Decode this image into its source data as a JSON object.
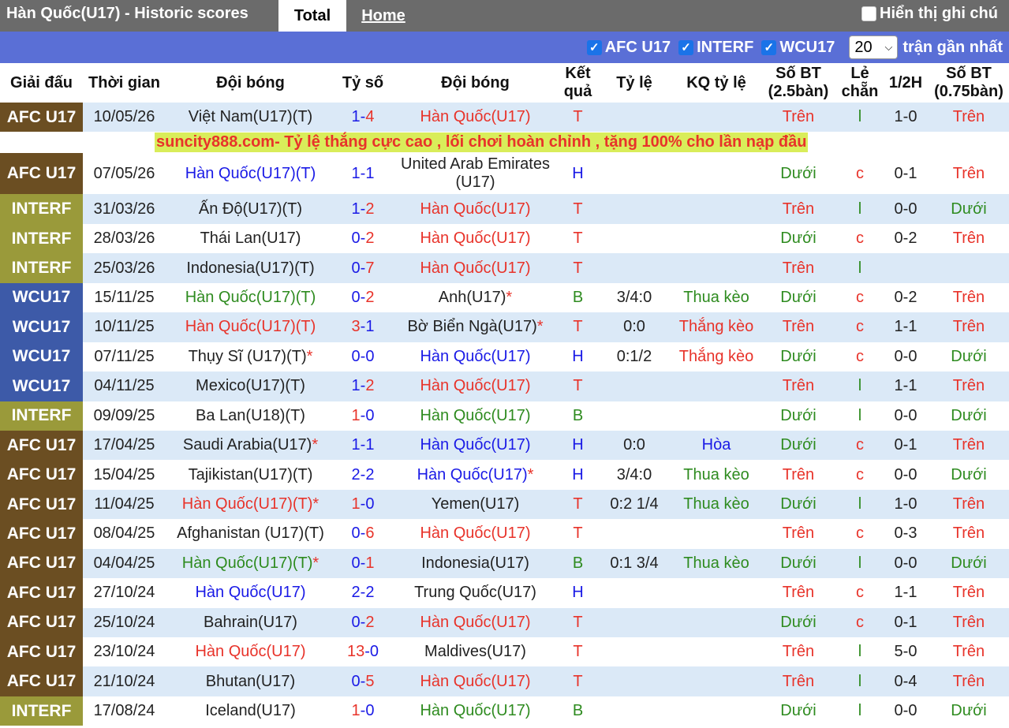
{
  "header": {
    "title": "Hàn Quốc(U17) - Historic scores",
    "tab_total": "Total",
    "tab_home": "Home",
    "show_note": "Hiển thị ghi chú"
  },
  "filters": {
    "afc": "AFC U17",
    "interf": "INTERF",
    "wcu": "WCU17",
    "count": "20",
    "count_label": "trận gần nhất"
  },
  "columns": [
    "Giải đấu",
    "Thời gian",
    "Đội bóng",
    "Tỷ số",
    "Đội bóng",
    "Kết quả",
    "Tỷ lệ",
    "KQ tỷ lệ",
    "Số BT (2.5bàn)",
    "Lẻ chẵn",
    "1/2H",
    "Số BT (0.75bàn)"
  ],
  "league_colors": {
    "AFC U17": "#6b4e22",
    "INTERF": "#9a9a3a",
    "WCU17": "#3d5aa8"
  },
  "promo": "suncity888.com- Tỷ lệ thắng cực cao , lối chơi hoàn chỉnh , tặng 100% cho lần nạp đầu",
  "rows": [
    {
      "league": "AFC U17",
      "date": "10/05/26",
      "home": "Việt Nam(U17)(T)",
      "hc": "black",
      "hs": false,
      "score": "1-4",
      "sa": "blue",
      "sb": "red",
      "away": "Hàn Quốc(U17)",
      "ac": "red",
      "as": false,
      "res": "T",
      "rc": "red",
      "odds": "",
      "kq": "",
      "kc": "",
      "ou": "Trên",
      "oc": "red",
      "oe": "l",
      "ec": "green",
      "ht": "1-0",
      "ou2": "Trên",
      "o2c": "red"
    },
    {
      "league": "AFC U17",
      "date": "07/05/26",
      "home": "Hàn Quốc(U17)(T)",
      "hc": "blue",
      "hs": false,
      "score": "1-1",
      "sa": "blue",
      "sb": "blue",
      "away": "United Arab Emirates (U17)",
      "ac": "black",
      "as": false,
      "res": "H",
      "rc": "blue",
      "odds": "",
      "kq": "",
      "kc": "",
      "ou": "Dưới",
      "oc": "green",
      "oe": "c",
      "ec": "red",
      "ht": "0-1",
      "ou2": "Trên",
      "o2c": "red"
    },
    {
      "league": "INTERF",
      "date": "31/03/26",
      "home": "Ấn Độ(U17)(T)",
      "hc": "black",
      "hs": false,
      "score": "1-2",
      "sa": "blue",
      "sb": "red",
      "away": "Hàn Quốc(U17)",
      "ac": "red",
      "as": false,
      "res": "T",
      "rc": "red",
      "odds": "",
      "kq": "",
      "kc": "",
      "ou": "Trên",
      "oc": "red",
      "oe": "l",
      "ec": "green",
      "ht": "0-0",
      "ou2": "Dưới",
      "o2c": "green"
    },
    {
      "league": "INTERF",
      "date": "28/03/26",
      "home": "Thái Lan(U17)",
      "hc": "black",
      "hs": false,
      "score": "0-2",
      "sa": "blue",
      "sb": "red",
      "away": "Hàn Quốc(U17)",
      "ac": "red",
      "as": false,
      "res": "T",
      "rc": "red",
      "odds": "",
      "kq": "",
      "kc": "",
      "ou": "Dưới",
      "oc": "green",
      "oe": "c",
      "ec": "red",
      "ht": "0-2",
      "ou2": "Trên",
      "o2c": "red"
    },
    {
      "league": "INTERF",
      "date": "25/03/26",
      "home": "Indonesia(U17)(T)",
      "hc": "black",
      "hs": false,
      "score": "0-7",
      "sa": "blue",
      "sb": "red",
      "away": "Hàn Quốc(U17)",
      "ac": "red",
      "as": false,
      "res": "T",
      "rc": "red",
      "odds": "",
      "kq": "",
      "kc": "",
      "ou": "Trên",
      "oc": "red",
      "oe": "l",
      "ec": "green",
      "ht": "",
      "ou2": "",
      "o2c": "red"
    },
    {
      "league": "WCU17",
      "date": "15/11/25",
      "home": "Hàn Quốc(U17)(T)",
      "hc": "green",
      "hs": false,
      "score": "0-2",
      "sa": "blue",
      "sb": "red",
      "away": "Anh(U17)",
      "ac": "black",
      "as": true,
      "res": "B",
      "rc": "green",
      "odds": "3/4:0",
      "kq": "Thua kèo",
      "kc": "green",
      "ou": "Dưới",
      "oc": "green",
      "oe": "c",
      "ec": "red",
      "ht": "0-2",
      "ou2": "Trên",
      "o2c": "red"
    },
    {
      "league": "WCU17",
      "date": "10/11/25",
      "home": "Hàn Quốc(U17)(T)",
      "hc": "red",
      "hs": false,
      "score": "3-1",
      "sa": "red",
      "sb": "blue",
      "away": "Bờ Biển Ngà(U17)",
      "ac": "black",
      "as": true,
      "res": "T",
      "rc": "red",
      "odds": "0:0",
      "kq": "Thắng kèo",
      "kc": "red",
      "ou": "Trên",
      "oc": "red",
      "oe": "c",
      "ec": "red",
      "ht": "1-1",
      "ou2": "Trên",
      "o2c": "red"
    },
    {
      "league": "WCU17",
      "date": "07/11/25",
      "home": "Thụy Sĩ (U17)(T)",
      "hc": "black",
      "hs": true,
      "score": "0-0",
      "sa": "blue",
      "sb": "blue",
      "away": "Hàn Quốc(U17)",
      "ac": "blue",
      "as": false,
      "res": "H",
      "rc": "blue",
      "odds": "0:1/2",
      "kq": "Thắng kèo",
      "kc": "red",
      "ou": "Dưới",
      "oc": "green",
      "oe": "c",
      "ec": "red",
      "ht": "0-0",
      "ou2": "Dưới",
      "o2c": "green"
    },
    {
      "league": "WCU17",
      "date": "04/11/25",
      "home": "Mexico(U17)(T)",
      "hc": "black",
      "hs": false,
      "score": "1-2",
      "sa": "blue",
      "sb": "red",
      "away": "Hàn Quốc(U17)",
      "ac": "red",
      "as": false,
      "res": "T",
      "rc": "red",
      "odds": "",
      "kq": "",
      "kc": "",
      "ou": "Trên",
      "oc": "red",
      "oe": "l",
      "ec": "green",
      "ht": "1-1",
      "ou2": "Trên",
      "o2c": "red"
    },
    {
      "league": "INTERF",
      "date": "09/09/25",
      "home": "Ba Lan(U18)(T)",
      "hc": "black",
      "hs": false,
      "score": "1-0",
      "sa": "red",
      "sb": "blue",
      "away": "Hàn Quốc(U17)",
      "ac": "green",
      "as": false,
      "res": "B",
      "rc": "green",
      "odds": "",
      "kq": "",
      "kc": "",
      "ou": "Dưới",
      "oc": "green",
      "oe": "l",
      "ec": "green",
      "ht": "0-0",
      "ou2": "Dưới",
      "o2c": "green"
    },
    {
      "league": "AFC U17",
      "date": "17/04/25",
      "home": "Saudi Arabia(U17)",
      "hc": "black",
      "hs": true,
      "score": "1-1",
      "sa": "blue",
      "sb": "blue",
      "away": "Hàn Quốc(U17)",
      "ac": "blue",
      "as": false,
      "res": "H",
      "rc": "blue",
      "odds": "0:0",
      "kq": "Hòa",
      "kc": "blue",
      "ou": "Dưới",
      "oc": "green",
      "oe": "c",
      "ec": "red",
      "ht": "0-1",
      "ou2": "Trên",
      "o2c": "red"
    },
    {
      "league": "AFC U17",
      "date": "15/04/25",
      "home": "Tajikistan(U17)(T)",
      "hc": "black",
      "hs": false,
      "score": "2-2",
      "sa": "blue",
      "sb": "blue",
      "away": "Hàn Quốc(U17)",
      "ac": "blue",
      "as": true,
      "res": "H",
      "rc": "blue",
      "odds": "3/4:0",
      "kq": "Thua kèo",
      "kc": "green",
      "ou": "Trên",
      "oc": "red",
      "oe": "c",
      "ec": "red",
      "ht": "0-0",
      "ou2": "Dưới",
      "o2c": "green"
    },
    {
      "league": "AFC U17",
      "date": "11/04/25",
      "home": "Hàn Quốc(U17)(T)",
      "hc": "red",
      "hs": true,
      "score": "1-0",
      "sa": "red",
      "sb": "blue",
      "away": "Yemen(U17)",
      "ac": "black",
      "as": false,
      "res": "T",
      "rc": "red",
      "odds": "0:2 1/4",
      "kq": "Thua kèo",
      "kc": "green",
      "ou": "Dưới",
      "oc": "green",
      "oe": "l",
      "ec": "green",
      "ht": "1-0",
      "ou2": "Trên",
      "o2c": "red"
    },
    {
      "league": "AFC U17",
      "date": "08/04/25",
      "home": "Afghanistan (U17)(T)",
      "hc": "black",
      "hs": false,
      "score": "0-6",
      "sa": "blue",
      "sb": "red",
      "away": "Hàn Quốc(U17)",
      "ac": "red",
      "as": false,
      "res": "T",
      "rc": "red",
      "odds": "",
      "kq": "",
      "kc": "",
      "ou": "Trên",
      "oc": "red",
      "oe": "c",
      "ec": "red",
      "ht": "0-3",
      "ou2": "Trên",
      "o2c": "red"
    },
    {
      "league": "AFC U17",
      "date": "04/04/25",
      "home": "Hàn Quốc(U17)(T)",
      "hc": "green",
      "hs": true,
      "score": "0-1",
      "sa": "blue",
      "sb": "red",
      "away": "Indonesia(U17)",
      "ac": "black",
      "as": false,
      "res": "B",
      "rc": "green",
      "odds": "0:1 3/4",
      "kq": "Thua kèo",
      "kc": "green",
      "ou": "Dưới",
      "oc": "green",
      "oe": "l",
      "ec": "green",
      "ht": "0-0",
      "ou2": "Dưới",
      "o2c": "green"
    },
    {
      "league": "AFC U17",
      "date": "27/10/24",
      "home": "Hàn Quốc(U17)",
      "hc": "blue",
      "hs": false,
      "score": "2-2",
      "sa": "blue",
      "sb": "blue",
      "away": "Trung Quốc(U17)",
      "ac": "black",
      "as": false,
      "res": "H",
      "rc": "blue",
      "odds": "",
      "kq": "",
      "kc": "",
      "ou": "Trên",
      "oc": "red",
      "oe": "c",
      "ec": "red",
      "ht": "1-1",
      "ou2": "Trên",
      "o2c": "red"
    },
    {
      "league": "AFC U17",
      "date": "25/10/24",
      "home": "Bahrain(U17)",
      "hc": "black",
      "hs": false,
      "score": "0-2",
      "sa": "blue",
      "sb": "red",
      "away": "Hàn Quốc(U17)",
      "ac": "red",
      "as": false,
      "res": "T",
      "rc": "red",
      "odds": "",
      "kq": "",
      "kc": "",
      "ou": "Dưới",
      "oc": "green",
      "oe": "c",
      "ec": "red",
      "ht": "0-1",
      "ou2": "Trên",
      "o2c": "red"
    },
    {
      "league": "AFC U17",
      "date": "23/10/24",
      "home": "Hàn Quốc(U17)",
      "hc": "red",
      "hs": false,
      "score": "13-0",
      "sa": "red",
      "sb": "blue",
      "away": "Maldives(U17)",
      "ac": "black",
      "as": false,
      "res": "T",
      "rc": "red",
      "odds": "",
      "kq": "",
      "kc": "",
      "ou": "Trên",
      "oc": "red",
      "oe": "l",
      "ec": "green",
      "ht": "5-0",
      "ou2": "Trên",
      "o2c": "red"
    },
    {
      "league": "AFC U17",
      "date": "21/10/24",
      "home": "Bhutan(U17)",
      "hc": "black",
      "hs": false,
      "score": "0-5",
      "sa": "blue",
      "sb": "red",
      "away": "Hàn Quốc(U17)",
      "ac": "red",
      "as": false,
      "res": "T",
      "rc": "red",
      "odds": "",
      "kq": "",
      "kc": "",
      "ou": "Trên",
      "oc": "red",
      "oe": "l",
      "ec": "green",
      "ht": "0-4",
      "ou2": "Trên",
      "o2c": "red"
    },
    {
      "league": "INTERF",
      "date": "17/08/24",
      "home": "Iceland(U17)",
      "hc": "black",
      "hs": false,
      "score": "1-0",
      "sa": "red",
      "sb": "blue",
      "away": "Hàn Quốc(U17)",
      "ac": "green",
      "as": false,
      "res": "B",
      "rc": "green",
      "odds": "",
      "kq": "",
      "kc": "",
      "ou": "Dưới",
      "oc": "green",
      "oe": "l",
      "ec": "green",
      "ht": "0-0",
      "ou2": "Dưới",
      "o2c": "green"
    }
  ]
}
